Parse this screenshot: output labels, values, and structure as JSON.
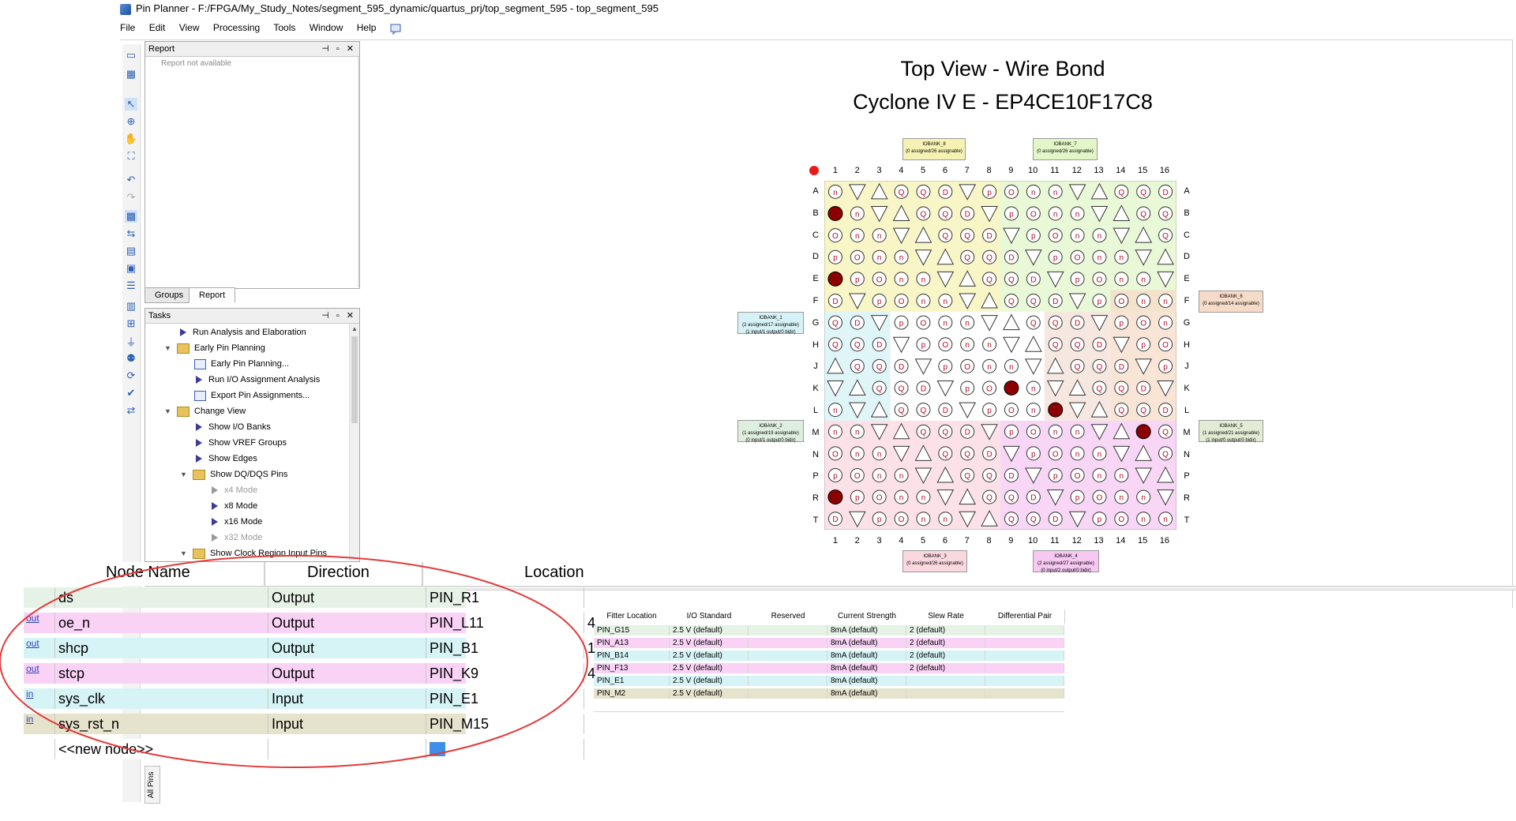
{
  "window": {
    "title": "Pin Planner - F:/FPGA/My_Study_Notes/segment_595_dynamic/quartus_prj/top_segment_595 - top_segment_595"
  },
  "menu": [
    "File",
    "Edit",
    "View",
    "Processing",
    "Tools",
    "Window",
    "Help"
  ],
  "report_panel": {
    "title": "Report",
    "empty_text": "Report not available"
  },
  "panel_tabs": [
    "Groups",
    "Report"
  ],
  "tasks_panel": {
    "title": "Tasks",
    "items": [
      {
        "label": "Run Analysis and Elaboration",
        "kind": "action",
        "indent": 0
      },
      {
        "label": "Early Pin Planning",
        "kind": "folder",
        "indent": 0
      },
      {
        "label": "Early Pin Planning...",
        "kind": "doc",
        "indent": 1
      },
      {
        "label": "Run I/O Assignment Analysis",
        "kind": "action",
        "indent": 1
      },
      {
        "label": "Export Pin Assignments...",
        "kind": "doc",
        "indent": 1
      },
      {
        "label": "Change View",
        "kind": "folder",
        "indent": 0
      },
      {
        "label": "Show I/O Banks",
        "kind": "action",
        "indent": 1
      },
      {
        "label": "Show VREF Groups",
        "kind": "action",
        "indent": 1
      },
      {
        "label": "Show Edges",
        "kind": "action",
        "indent": 1
      },
      {
        "label": "Show DQ/DQS Pins",
        "kind": "folder",
        "indent": 1
      },
      {
        "label": "x4 Mode",
        "kind": "action-disabled",
        "indent": 2
      },
      {
        "label": "x8 Mode",
        "kind": "action",
        "indent": 2
      },
      {
        "label": "x16 Mode",
        "kind": "action",
        "indent": 2
      },
      {
        "label": "x32 Mode",
        "kind": "action-disabled",
        "indent": 2
      },
      {
        "label": "Show Clock Region Input Pins",
        "kind": "folder",
        "indent": 1
      }
    ]
  },
  "package_view": {
    "title_line1": "Top View - Wire Bond",
    "title_line2": "Cyclone IV E - EP4CE10F17C8",
    "columns": [
      "1",
      "2",
      "3",
      "4",
      "5",
      "6",
      "7",
      "8",
      "9",
      "10",
      "11",
      "12",
      "13",
      "14",
      "15",
      "16"
    ],
    "rows": [
      "A",
      "B",
      "C",
      "D",
      "E",
      "F",
      "G",
      "H",
      "J",
      "K",
      "L",
      "M",
      "N",
      "P",
      "R",
      "T"
    ],
    "banks": [
      {
        "name": "IOBANK_8",
        "line2": "(0 assigned/26 assignable)",
        "color": "#f6f2b4"
      },
      {
        "name": "IOBANK_7",
        "line2": "(0 assigned/26 assignable)",
        "color": "#e2f6c8"
      },
      {
        "name": "IOBANK_1",
        "line2": "(2 assigned/17 assignable)",
        "line3": "(1 input/1 output/0 bidir)",
        "color": "#d6f2f6"
      },
      {
        "name": "IOBANK_6",
        "line2": "(0 assigned/14 assignable)",
        "color": "#f6dcc8"
      },
      {
        "name": "IOBANK_2",
        "line2": "(1 assigned/19 assignable)",
        "line3": "(0 input/1 output/0 bidir)",
        "color": "#dfefdf"
      },
      {
        "name": "IOBANK_5",
        "line2": "(1 assigned/21 assignable)",
        "line3": "(1 input/0 output/0 bidir)",
        "color": "#e2ecd4"
      },
      {
        "name": "IOBANK_3",
        "line2": "(0 assigned/26 assignable)",
        "color": "#fbd8e0"
      },
      {
        "name": "IOBANK_4",
        "line2": "(2 assigned/27 assignable)",
        "line3": "(0 input/2 output/0 bidir)",
        "color": "#f6c8f2"
      }
    ]
  },
  "all_pins_table": {
    "side_tab": "All Pins",
    "columns": [
      "Fitter Location",
      "I/O Standard",
      "Reserved",
      "Current Strength",
      "Slew Rate",
      "Differential Pair"
    ],
    "rows": [
      {
        "fitter": "PIN_G15",
        "io": "2.5 V (default)",
        "reserved": "",
        "strength": "8mA (default)",
        "slew": "2 (default)",
        "color": "#e6f2e6"
      },
      {
        "fitter": "PIN_A13",
        "io": "2.5 V (default)",
        "reserved": "",
        "strength": "8mA (default)",
        "slew": "2 (default)",
        "color": "#f9d2f6"
      },
      {
        "fitter": "PIN_B14",
        "io": "2.5 V (default)",
        "reserved": "",
        "strength": "8mA (default)",
        "slew": "2 (default)",
        "color": "#d6f4f6"
      },
      {
        "fitter": "PIN_F13",
        "io": "2.5 V (default)",
        "reserved": "",
        "strength": "8mA (default)",
        "slew": "2 (default)",
        "color": "#f9d2f6"
      },
      {
        "fitter": "PIN_E1",
        "io": "2.5 V (default)",
        "reserved": "",
        "strength": "8mA (default)",
        "slew": "",
        "color": "#d6f4f6"
      },
      {
        "fitter": "PIN_M2",
        "io": "2.5 V (default)",
        "reserved": "",
        "strength": "8mA (default)",
        "slew": "",
        "color": "#e6e3cc"
      }
    ]
  },
  "zoom_overlay": {
    "headers": [
      "Node Name",
      "Direction",
      "Location"
    ],
    "rows": [
      {
        "icon": "",
        "name": "ds",
        "direction": "Output",
        "location": "PIN_R1",
        "extra": "",
        "color": "#e6f2e6"
      },
      {
        "icon": "out",
        "name": "oe_n",
        "direction": "Output",
        "location": "PIN_L11",
        "extra": "4",
        "color": "#f9d2f6"
      },
      {
        "icon": "out",
        "name": "shcp",
        "direction": "Output",
        "location": "PIN_B1",
        "extra": "1",
        "color": "#d6f4f6"
      },
      {
        "icon": "out",
        "name": "stcp",
        "direction": "Output",
        "location": "PIN_K9",
        "extra": "4",
        "color": "#f9d2f6"
      },
      {
        "icon": "in",
        "name": "sys_clk",
        "direction": "Input",
        "location": "PIN_E1",
        "extra": "",
        "color": "#d6f4f6"
      },
      {
        "icon": "in",
        "name": "sys_rst_n",
        "direction": "Input",
        "location": "PIN_M15",
        "extra": "",
        "color": "#e6e3cc"
      }
    ],
    "new_node_row": "<<new node>>"
  },
  "colors": {
    "accent_red_ellipse": "#e23b3b",
    "assigned_pin": "#8b0000",
    "selection_blue": "#3d8fe8"
  }
}
